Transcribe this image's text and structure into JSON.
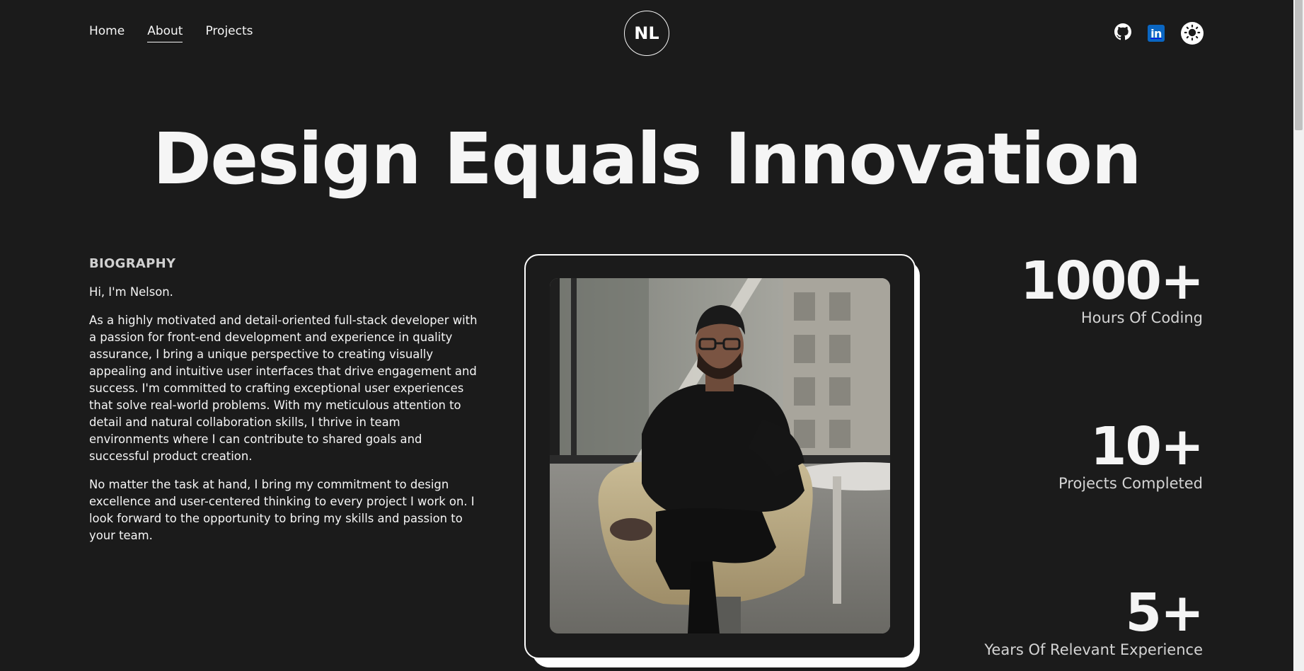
{
  "nav": {
    "items": [
      {
        "label": "Home",
        "active": false
      },
      {
        "label": "About",
        "active": true
      },
      {
        "label": "Projects",
        "active": false
      }
    ]
  },
  "logo": {
    "text": "NL"
  },
  "social": {
    "icons": [
      "github-icon",
      "linkedin-icon",
      "sun-icon"
    ],
    "linkedin_glyph": "in"
  },
  "hero": {
    "title": "Design Equals Innovation"
  },
  "biography": {
    "heading": "BIOGRAPHY",
    "greeting": "Hi, I'm Nelson.",
    "paragraph_1": "As a highly motivated and detail-oriented full-stack developer with a passion for front-end development and experience in quality assurance, I bring a unique perspective to creating visually appealing and intuitive user interfaces that drive engagement and success. I'm committed to crafting exceptional user experiences that solve real-world problems. With my meticulous attention to detail and natural collaboration skills, I thrive in team environments where I can contribute to shared goals and successful product creation.",
    "paragraph_2": "No matter the task at hand, I bring my commitment to design excellence and user-centered thinking to every project I work on. I look forward to the opportunity to bring my skills and passion to your team."
  },
  "stats": [
    {
      "value": "1000+",
      "label": "Hours Of Coding"
    },
    {
      "value": "10+",
      "label": "Projects Completed"
    },
    {
      "value": "5+",
      "label": "Years Of Relevant Experience"
    }
  ],
  "colors": {
    "background": "#1b1b1b",
    "text": "#f5f5f5",
    "linkedin": "#0a66c2"
  }
}
